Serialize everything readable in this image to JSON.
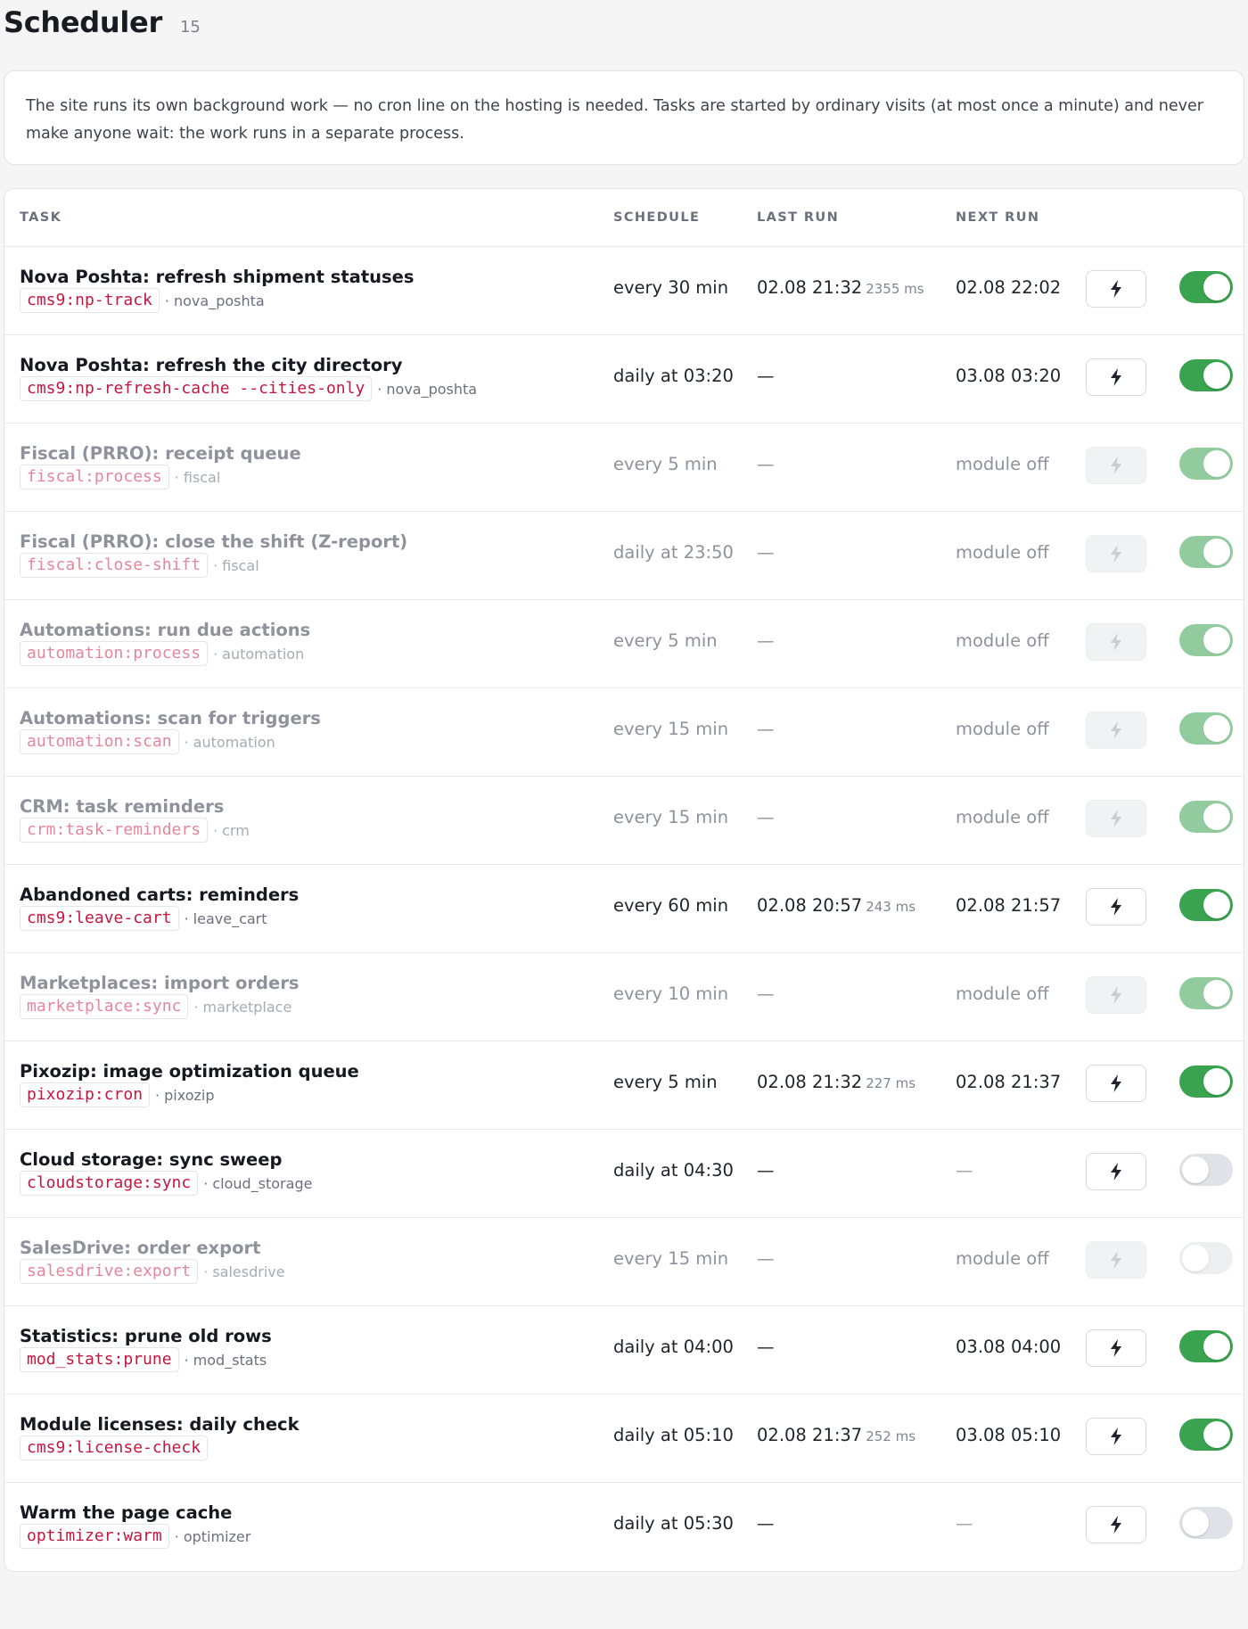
{
  "header": {
    "title": "Scheduler",
    "count": "15"
  },
  "intro": {
    "text": "The site runs its own background work — no cron line on the hosting is needed. Tasks are started by ordinary visits (at most once a minute) and never make anyone wait: the work runs in a separate process."
  },
  "table": {
    "headers": {
      "task": "TASK",
      "schedule": "SCHEDULE",
      "last_run": "LAST RUN",
      "next_run": "NEXT RUN"
    },
    "rows": [
      {
        "name": "Nova Poshta: refresh shipment statuses",
        "command": "cms9:np-track",
        "module": "nova_poshta",
        "schedule": "every 30 min",
        "last_run": "02.08 21:32",
        "duration": "2355 ms",
        "next_run": "02.08 22:02",
        "module_off": false,
        "enabled": true
      },
      {
        "name": "Nova Poshta: refresh the city directory",
        "command": "cms9:np-refresh-cache --cities-only",
        "module": "nova_poshta",
        "schedule": "daily at 03:20",
        "last_run": "—",
        "duration": "",
        "next_run": "03.08 03:20",
        "module_off": false,
        "enabled": true
      },
      {
        "name": "Fiscal (PRRO): receipt queue",
        "command": "fiscal:process",
        "module": "fiscal",
        "schedule": "every 5 min",
        "last_run": "—",
        "duration": "",
        "next_run": "module off",
        "module_off": true,
        "enabled": true
      },
      {
        "name": "Fiscal (PRRO): close the shift (Z-report)",
        "command": "fiscal:close-shift",
        "module": "fiscal",
        "schedule": "daily at 23:50",
        "last_run": "—",
        "duration": "",
        "next_run": "module off",
        "module_off": true,
        "enabled": true
      },
      {
        "name": "Automations: run due actions",
        "command": "automation:process",
        "module": "automation",
        "schedule": "every 5 min",
        "last_run": "—",
        "duration": "",
        "next_run": "module off",
        "module_off": true,
        "enabled": true
      },
      {
        "name": "Automations: scan for triggers",
        "command": "automation:scan",
        "module": "automation",
        "schedule": "every 15 min",
        "last_run": "—",
        "duration": "",
        "next_run": "module off",
        "module_off": true,
        "enabled": true
      },
      {
        "name": "CRM: task reminders",
        "command": "crm:task-reminders",
        "module": "crm",
        "schedule": "every 15 min",
        "last_run": "—",
        "duration": "",
        "next_run": "module off",
        "module_off": true,
        "enabled": true
      },
      {
        "name": "Abandoned carts: reminders",
        "command": "cms9:leave-cart",
        "module": "leave_cart",
        "schedule": "every 60 min",
        "last_run": "02.08 20:57",
        "duration": "243 ms",
        "next_run": "02.08 21:57",
        "module_off": false,
        "enabled": true
      },
      {
        "name": "Marketplaces: import orders",
        "command": "marketplace:sync",
        "module": "marketplace",
        "schedule": "every 10 min",
        "last_run": "—",
        "duration": "",
        "next_run": "module off",
        "module_off": true,
        "enabled": true
      },
      {
        "name": "Pixozip: image optimization queue",
        "command": "pixozip:cron",
        "module": "pixozip",
        "schedule": "every 5 min",
        "last_run": "02.08 21:32",
        "duration": "227 ms",
        "next_run": "02.08 21:37",
        "module_off": false,
        "enabled": true
      },
      {
        "name": "Cloud storage: sync sweep",
        "command": "cloudstorage:sync",
        "module": "cloud_storage",
        "schedule": "daily at 04:30",
        "last_run": "—",
        "duration": "",
        "next_run": "—",
        "module_off": false,
        "enabled": false
      },
      {
        "name": "SalesDrive: order export",
        "command": "salesdrive:export",
        "module": "salesdrive",
        "schedule": "every 15 min",
        "last_run": "—",
        "duration": "",
        "next_run": "module off",
        "module_off": true,
        "enabled": false
      },
      {
        "name": "Statistics: prune old rows",
        "command": "mod_stats:prune",
        "module": "mod_stats",
        "schedule": "daily at 04:00",
        "last_run": "—",
        "duration": "",
        "next_run": "03.08 04:00",
        "module_off": false,
        "enabled": true
      },
      {
        "name": "Module licenses: daily check",
        "command": "cms9:license-check",
        "module": "",
        "schedule": "daily at 05:10",
        "last_run": "02.08 21:37",
        "duration": "252 ms",
        "next_run": "03.08 05:10",
        "module_off": false,
        "enabled": true
      },
      {
        "name": "Warm the page cache",
        "command": "optimizer:warm",
        "module": "optimizer",
        "schedule": "daily at 05:30",
        "last_run": "—",
        "duration": "",
        "next_run": "—",
        "module_off": false,
        "enabled": false
      }
    ]
  },
  "colors": {
    "toggle_on": "#3aa34f",
    "command_text": "#c6153f",
    "page_background": "#f5f5f6"
  },
  "icons": {
    "run_button": "lightning-icon"
  }
}
